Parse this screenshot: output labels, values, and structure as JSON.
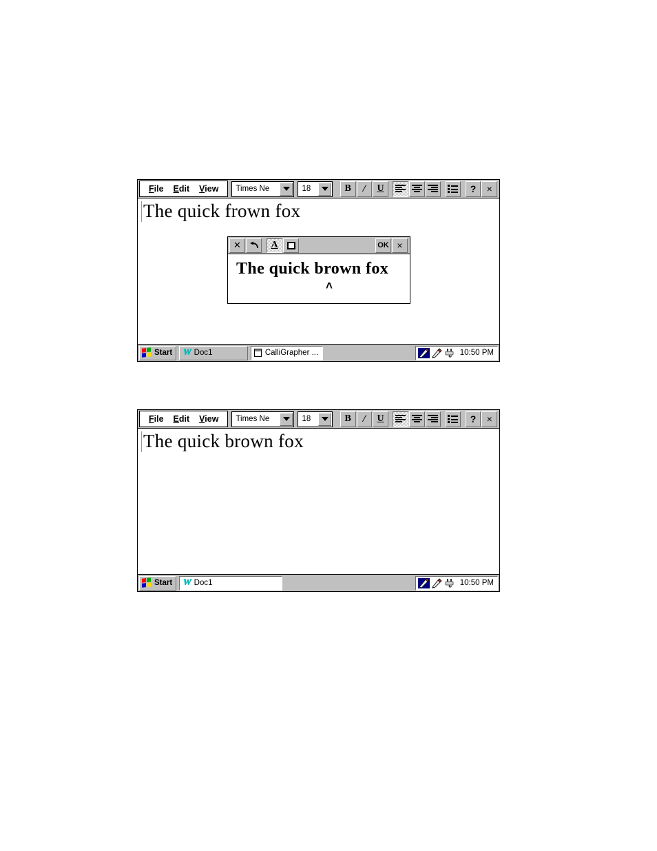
{
  "app": {
    "title": "Doc1",
    "os_style": "Windows 95 / Pen Computing"
  },
  "toolbar": {
    "menu": [
      {
        "name": "file",
        "label": "File",
        "accel": "F"
      },
      {
        "name": "edit",
        "label": "Edit",
        "accel": "E"
      },
      {
        "name": "view",
        "label": "View",
        "accel": "V"
      }
    ],
    "font_name": "Times Ne",
    "font_name_placeholder": "Times New Roman",
    "font_size": "18",
    "font_size_placeholder": "18",
    "buttons": [
      {
        "name": "bold-button",
        "icon": "bold-icon",
        "label": "B",
        "pressed": false
      },
      {
        "name": "italic-button",
        "icon": "italic-icon",
        "label": "I",
        "pressed": false
      },
      {
        "name": "underline-button",
        "icon": "underline-icon",
        "label": "U",
        "pressed": false
      },
      {
        "name": "align-left-button",
        "icon": "align-left-icon",
        "label": "",
        "pressed": true
      },
      {
        "name": "align-center-button",
        "icon": "align-center-icon",
        "label": "",
        "pressed": false
      },
      {
        "name": "align-right-button",
        "icon": "align-right-icon",
        "label": "",
        "pressed": false
      },
      {
        "name": "bullet-list-button",
        "icon": "bullet-list-icon",
        "label": "",
        "pressed": false
      },
      {
        "name": "help-button",
        "icon": "question-mark-icon",
        "label": "?",
        "pressed": false
      },
      {
        "name": "close-button",
        "icon": "close-x-icon",
        "label": "×",
        "pressed": false
      }
    ]
  },
  "window_top": {
    "document_text": "The quick frown fox",
    "taskbar": {
      "start_label": "Start",
      "tasks": [
        {
          "name": "taskbar-item-doc1",
          "label": "Doc1",
          "icon": "wordpad-w-icon",
          "active": false
        },
        {
          "name": "taskbar-item-calligrapher",
          "label": "CalliGrapher ...",
          "icon": "calligrapher-window-icon",
          "active": true
        }
      ],
      "tray": {
        "icons": [
          "pen-input-icon",
          "ink-pen-icon",
          "power-plug-icon"
        ],
        "time": "10:50 PM"
      }
    },
    "popup": {
      "buttons": [
        {
          "name": "popup-clear-button",
          "icon": "x-icon",
          "label": "✕",
          "pressed": false
        },
        {
          "name": "popup-undo-button",
          "icon": "undo-arrow-icon",
          "label": "↶",
          "pressed": false
        },
        {
          "name": "popup-letter-button",
          "icon": "letter-a-icon",
          "label": "A",
          "pressed": true
        },
        {
          "name": "popup-box-button",
          "icon": "rectangle-icon",
          "label": "",
          "pressed": false
        }
      ],
      "ok_label": "OK",
      "close_label": "×",
      "recognized_text": "The quick brown fox",
      "caret_glyph": "˄"
    }
  },
  "window_bottom": {
    "document_text": "The quick brown fox",
    "taskbar": {
      "start_label": "Start",
      "tasks": [
        {
          "name": "taskbar-item-doc1",
          "label": "Doc1",
          "icon": "wordpad-w-icon",
          "active": true
        }
      ],
      "tray": {
        "icons": [
          "pen-input-icon",
          "ink-pen-icon",
          "power-plug-icon"
        ],
        "time": "10:50 PM"
      }
    }
  },
  "colors": {
    "face": "#c0c0c0",
    "shadow": "#707070",
    "highlight": "#ffffff",
    "text": "#000000",
    "w_icon": "#00c8c8"
  }
}
